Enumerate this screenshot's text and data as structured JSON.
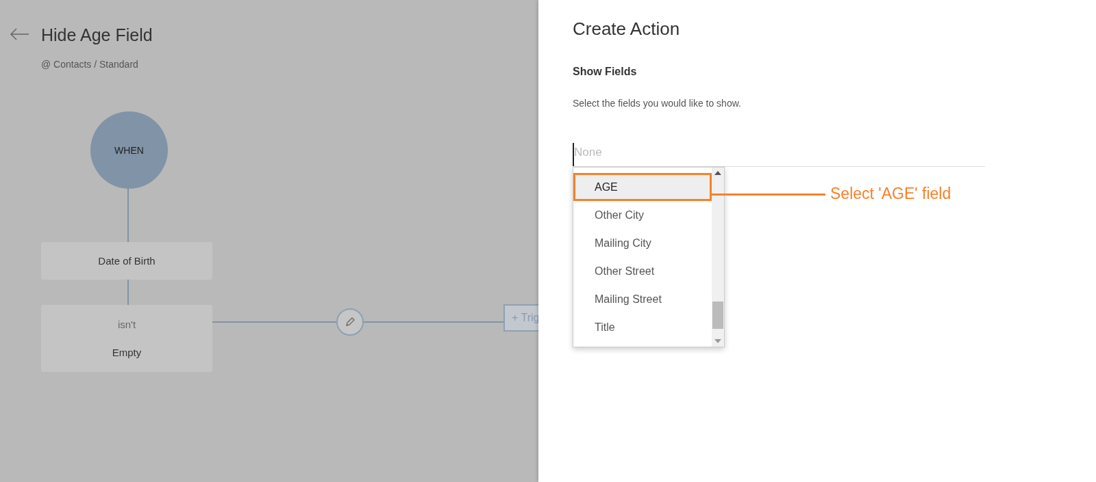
{
  "page": {
    "title": "Hide Age Field",
    "breadcrumb": "@ Contacts / Standard"
  },
  "flow": {
    "when": "WHEN",
    "field": "Date of Birth",
    "operator": "isn't",
    "value": "Empty",
    "trigger_button": "+ Trig"
  },
  "panel": {
    "title": "Create Action",
    "section": "Show Fields",
    "description": "Select the fields you would like to show.",
    "field": {
      "placeholder": "None"
    },
    "options": [
      {
        "label": "AGE",
        "selected": true
      },
      {
        "label": "Other City",
        "selected": false
      },
      {
        "label": "Mailing City",
        "selected": false
      },
      {
        "label": "Other Street",
        "selected": false
      },
      {
        "label": "Mailing Street",
        "selected": false
      },
      {
        "label": "Title",
        "selected": false
      }
    ]
  },
  "annotation": {
    "text": "Select 'AGE' field"
  }
}
